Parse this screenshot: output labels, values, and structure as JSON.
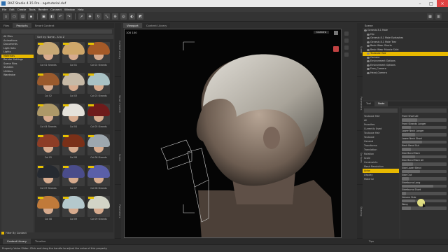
{
  "window": {
    "title": "DAZ Studio 4.15 Pro - agetutorial.duf"
  },
  "menu": [
    "File",
    "Edit",
    "Create",
    "Tools",
    "Render",
    "Connect",
    "Window",
    "Help"
  ],
  "left": {
    "tabs": [
      "Files",
      "Products",
      "Smart Content"
    ],
    "categories": [
      "All Files",
      "Animations",
      "Documents",
      "Light Sets",
      "Lights",
      "Materials",
      "Render Settings",
      "Scene Files",
      "Shaders",
      "Utilities",
      "Wardrobe"
    ],
    "selected_category": "Materials",
    "sort_label": "Sort by: Name - A to Z",
    "filter_label": "Filter By Context",
    "tiles": [
      {
        "label": "Col 01 Strands",
        "hair": "#c7a875"
      },
      {
        "label": "Col 01",
        "hair": "#cfa76a"
      },
      {
        "label": "Col 02 Strands",
        "hair": "#a55a28"
      },
      {
        "label": "Col 02",
        "hair": "#9a5a2d"
      },
      {
        "label": "Col 03",
        "hair": "#c6b9a6"
      },
      {
        "label": "Col 03 Strands",
        "hair": "#a8c1c4"
      },
      {
        "label": "Col 04 Strands",
        "hair": "#ad9868"
      },
      {
        "label": "Col 04",
        "hair": "#e4e1da"
      },
      {
        "label": "Col 05 Strands",
        "hair": "#6e1b1b"
      },
      {
        "label": "Col 05",
        "hair": "#8d3d26"
      },
      {
        "label": "Col 06",
        "hair": "#7a3018"
      },
      {
        "label": "Col 06 Strands",
        "hair": "#9da7ae"
      },
      {
        "label": "Col 07 Strands",
        "hair": "#262a30"
      },
      {
        "label": "Col 07",
        "hair": "#4a4c8a"
      },
      {
        "label": "Col 08 Strands",
        "hair": "#5a5fa8"
      },
      {
        "label": "Col 08",
        "hair": "#c07a3a"
      },
      {
        "label": "Col 09",
        "hair": "#b4c8cc"
      },
      {
        "label": "Col 09 Strands",
        "hair": "#d2d4c6"
      }
    ]
  },
  "left_vtabs": [
    "Content Library",
    "Smart Content",
    "Scene",
    "Parameters"
  ],
  "viewport": {
    "tabs": [
      "Viewport",
      "Content Library"
    ],
    "camera": "Camera",
    "counter": "100  100"
  },
  "right_vtabs": [
    "Scene",
    "Parameters",
    "Surfaces",
    "Shaping"
  ],
  "scene": {
    "header": "Scene",
    "items": [
      "Genesis 8.1 Male",
      "Hip",
      "Genesis 8.1 Male Eyelashes",
      "Genesis 8.1 Male Tear",
      "Basic Wear Shorts",
      "Basic Wear Muscle Shirt",
      "Toulouse Hair",
      "Camera",
      "Environment Options",
      "Environment Options",
      "Face_Camera",
      "Head_Camera"
    ],
    "selected": "Toulouse Hair"
  },
  "parameters": {
    "tabs": [
      "Tool",
      "Node"
    ],
    "tree_items": [
      "Toulouse Hair",
      "All",
      "Favorites",
      "Currently Used",
      "Toulouse Hair",
      "Toulouse",
      "General",
      "Transforms",
      "Translation",
      "Rotation",
      "Scale",
      "Constraints",
      "Mesh Resolution",
      "Actor",
      "Display",
      "Material"
    ],
    "selected_tree": "Actor",
    "props": [
      {
        "label": "Front Short All",
        "value": 0.35
      },
      {
        "label": "Front Strands Longer",
        "value": 0.2
      },
      {
        "label": "Lower Neck Longer",
        "value": 0.3
      },
      {
        "label": "Lower Neck Short",
        "value": 0.45
      },
      {
        "label": "Neck Bend Out",
        "value": 0.2
      },
      {
        "label": "Side Bend More",
        "value": 0.3
      },
      {
        "label": "Side Bend More All",
        "value": 0.25
      },
      {
        "label": "Side Lower Bend",
        "value": 0.4
      },
      {
        "label": "Side Out",
        "value": 0.15
      },
      {
        "label": "Sidelburns Long",
        "value": 0.7
      },
      {
        "label": "Sidelburns Short",
        "value": 0.1
      },
      {
        "label": "Volume Side",
        "value": 0.3
      },
      {
        "label": "Wavy",
        "value": 0.2
      }
    ],
    "show_sub_items": "Show Sub Items"
  },
  "bottom_tabs": [
    "Content Library",
    "Timeline",
    "Tips"
  ],
  "status": "Property Value Slider: Click and drag the handle to adjust the value of this property"
}
